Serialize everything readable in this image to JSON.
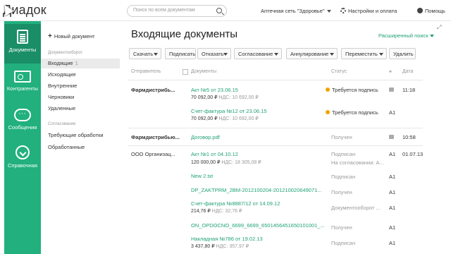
{
  "topbar": {
    "logo": "Диадок",
    "search_placeholder": "Поиск по всем документам",
    "org": "Аптечная сеть \"Здоровье\"",
    "settings": "Настройки и оплата",
    "help": "Помощь"
  },
  "leftnav": [
    {
      "label": "Документы",
      "icon": "documents-icon"
    },
    {
      "label": "Контрагенты",
      "icon": "contacts-icon"
    },
    {
      "label": "Сообщения",
      "icon": "messages-icon"
    },
    {
      "label": "Справочная",
      "icon": "help-center-icon"
    }
  ],
  "sidebar": {
    "new_doc": "Новый документ",
    "section1": "Документооборот",
    "items1": [
      {
        "label": "Входящие",
        "count": "1"
      },
      {
        "label": "Исходящие"
      },
      {
        "label": "Внутренние"
      },
      {
        "label": "Черновики"
      },
      {
        "label": "Удаленные"
      }
    ],
    "section2": "Согласование",
    "items2": [
      {
        "label": "Требующие обработки"
      },
      {
        "label": "Обработанные"
      }
    ]
  },
  "main": {
    "title": "Входящие документы",
    "advanced_search": "Расширенный поиск",
    "toolbar": {
      "download": "Скачать",
      "sign": "Подписать",
      "reject": "Отказать",
      "approval": "Согласование",
      "annul": "Аннулирование",
      "move": "Переместить",
      "delete": "Удалить"
    },
    "headers": {
      "sender": "Отправитель",
      "documents": "Документы",
      "status": "Статус",
      "date": "Дата"
    },
    "rows": [
      {
        "sender": "Фармдистрибь...",
        "doc": "Акт №5 от 23.06.15",
        "amount": "70 092,00 ₽",
        "vat": "НДС: 10 692,00 ₽",
        "status": "Требуется подпись",
        "status_dot": true,
        "user": "",
        "date": "11:18"
      },
      {
        "sender": "",
        "doc": "Счет-фактура №12 от 23.06.15",
        "amount": "70 092,00 ₽",
        "vat": "НДС: 10 692,00 ₽",
        "status": "Требуется подпись",
        "status_dot": true,
        "user": "A1",
        "date": ""
      },
      {
        "sender": "Фармдистрибью...",
        "doc": "Договор.pdf",
        "amount": "",
        "vat": "",
        "status": "Получен",
        "user": "",
        "date": "10:58"
      },
      {
        "sender": "ООО Организац...",
        "doc": "Акт №1 от 04.10.12",
        "amount": "120 000,00 ₽",
        "vat": "НДС: 18 305,08 ₽",
        "status": "Подписан",
        "status2": "На согласовании: А...",
        "user": "A1",
        "date": "01.07.13"
      },
      {
        "sender": "",
        "doc": "New 2.txt",
        "status": "Подписан",
        "user": "A1"
      },
      {
        "sender": "",
        "doc": "DP_ZAKTPRM_2BM-2012100204-201210020649071...",
        "status": "Получен",
        "user": "A1"
      },
      {
        "sender": "",
        "doc": "Счет-фактура №8887/12 от 14.09.12",
        "amount": "214,76 ₽",
        "vat": "НДС: 32,76 ₽",
        "status": "Документооборот ...",
        "user": "A1"
      },
      {
        "sender": "",
        "doc": "ON_OPDOCNO_6699_6699_6501456451650101001_...",
        "status": "Получен",
        "user": "A1"
      },
      {
        "sender": "",
        "doc": "Накладная №786 от 19.02.13",
        "amount": "3 437,80 ₽",
        "vat": "НДС: 357,97 ₽",
        "status": "Подписан",
        "user": "A1"
      }
    ]
  }
}
